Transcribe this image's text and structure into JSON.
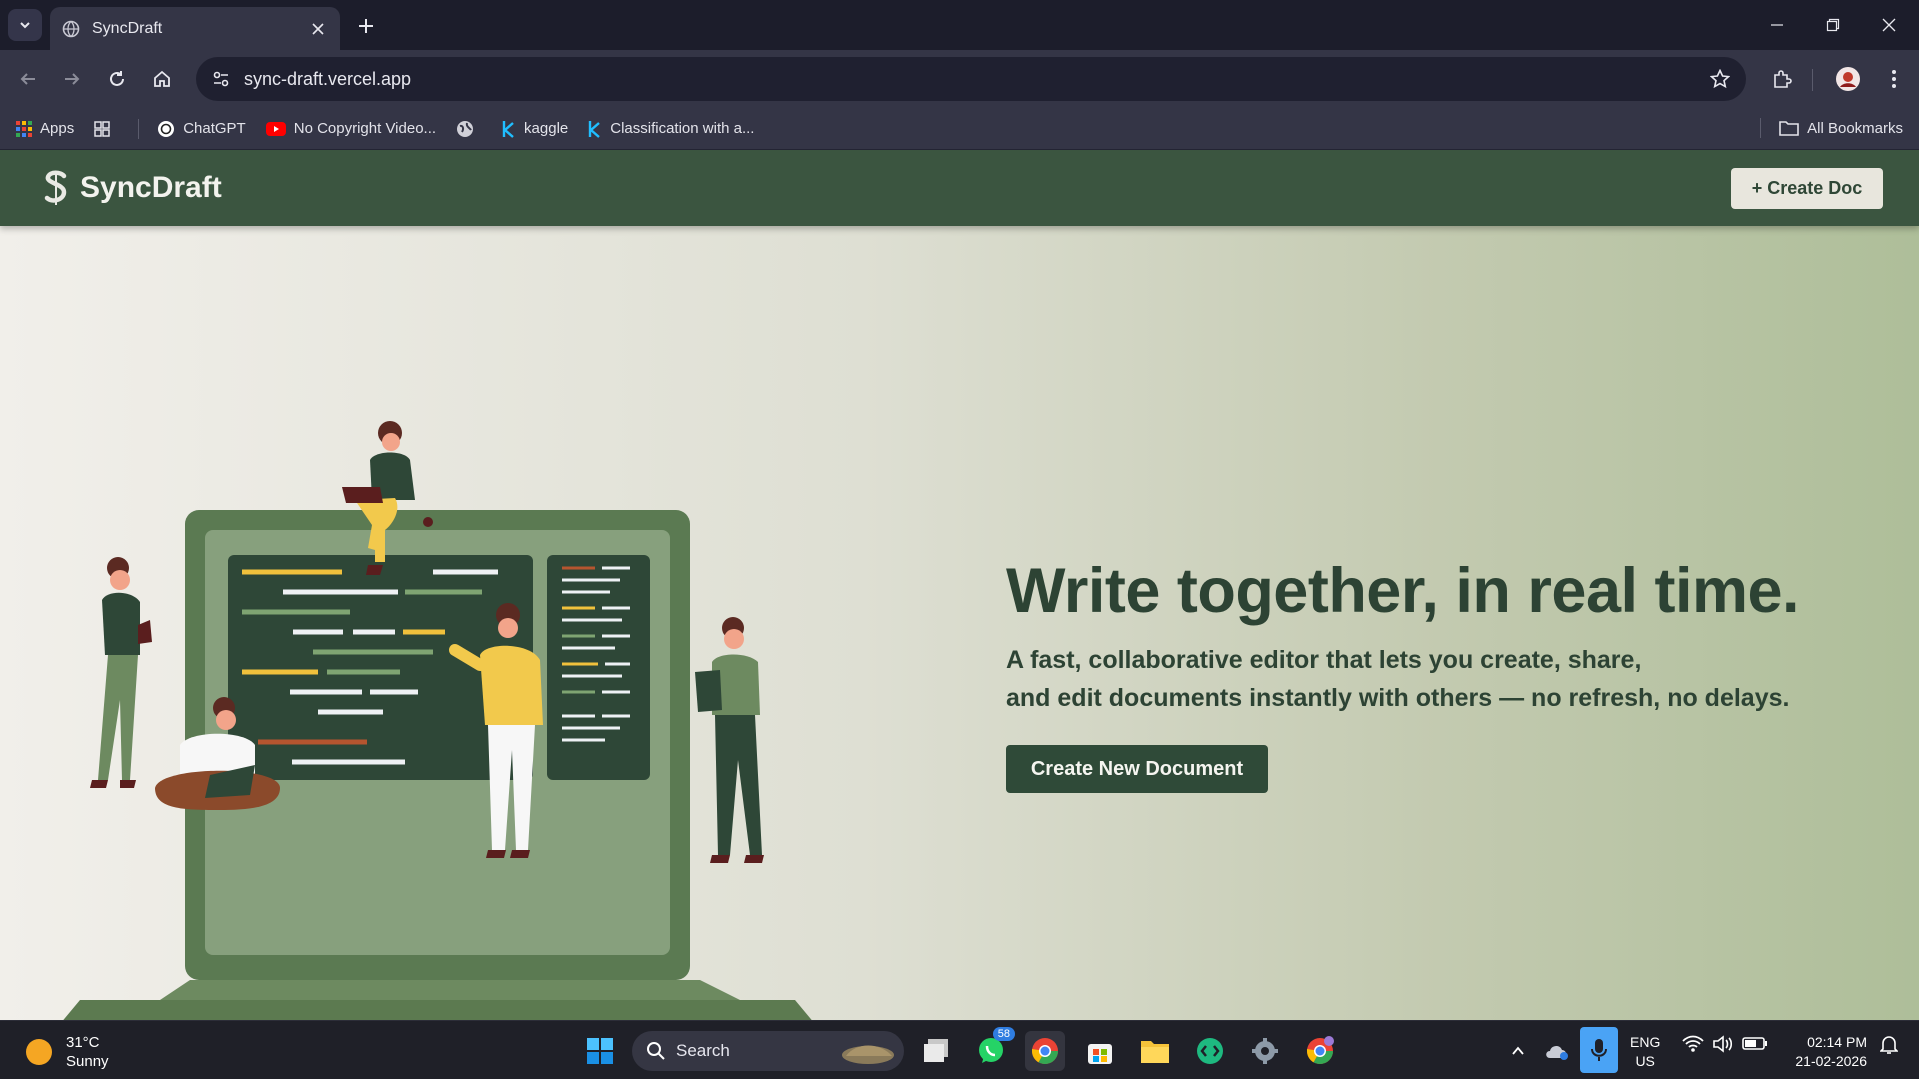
{
  "browser": {
    "tab_title": "SyncDraft",
    "url": "sync-draft.vercel.app",
    "bookmarks": [
      {
        "label": "Apps",
        "icon": "apps-grid-icon"
      },
      {
        "label": "ChatGPT",
        "icon": "chatgpt-icon"
      },
      {
        "label": "No Copyright Video...",
        "icon": "youtube-icon"
      },
      {
        "label": "kaggle",
        "icon": "kaggle-icon"
      },
      {
        "label": "Classification with a...",
        "icon": "kaggle-icon"
      }
    ],
    "all_bookmarks": "All Bookmarks"
  },
  "app": {
    "brand": "SyncDraft",
    "create_doc_button": "+ Create Doc",
    "brand_color": "#3b5540"
  },
  "hero": {
    "headline": "Write together, in real time.",
    "subtitle_line1": "A fast, collaborative editor that lets you create, share,",
    "subtitle_line2": "and edit documents instantly with others — no refresh, no delays.",
    "cta": "Create New Document"
  },
  "taskbar": {
    "temperature": "31°C",
    "weather": "Sunny",
    "search_label": "Search",
    "whatsapp_badge": "58",
    "lang_line1": "ENG",
    "lang_line2": "US",
    "time": "02:14 PM",
    "date": "21-02-2026"
  }
}
